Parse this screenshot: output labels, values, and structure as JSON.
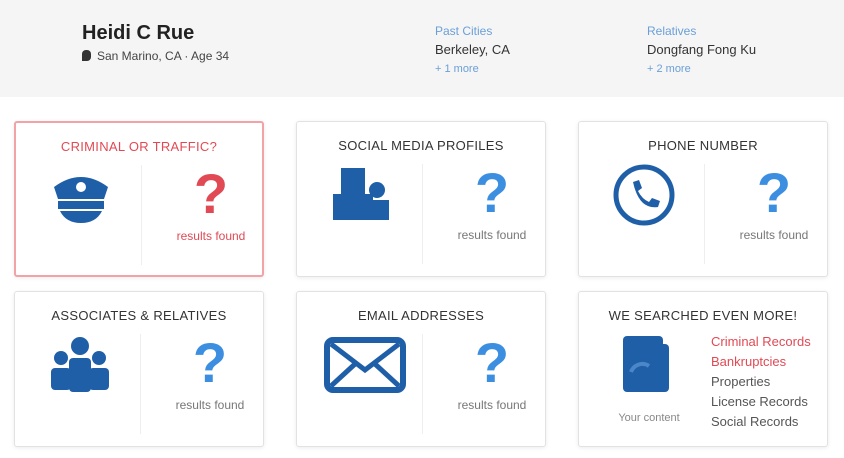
{
  "header": {
    "name": "Heidi C Rue",
    "location": "San Marino, CA · Age 34",
    "past_cities": {
      "label": "Past Cities",
      "value": "Berkeley, CA",
      "more": "+ 1 more"
    },
    "relatives": {
      "label": "Relatives",
      "value": "Dongfang Fong Ku",
      "more": "+ 2 more"
    }
  },
  "cards": [
    {
      "title": "CRIMINAL OR TRAFFIC?",
      "q": "?",
      "result": "results found"
    },
    {
      "title": "SOCIAL MEDIA PROFILES",
      "q": "?",
      "result": "results found"
    },
    {
      "title": "PHONE NUMBER",
      "q": "?",
      "result": "results found"
    },
    {
      "title": "ASSOCIATES & RELATIVES",
      "q": "?",
      "result": "results found"
    },
    {
      "title": "EMAIL ADDRESSES",
      "q": "?",
      "result": "results found"
    },
    {
      "title": "WE SEARCHED EVEN MORE!",
      "caption": "Your content",
      "items": [
        "Criminal Records",
        "Bankruptcies",
        "Properties",
        "License Records",
        "Social Records"
      ]
    }
  ],
  "colors": {
    "accent": "#1f5fa8",
    "alert": "#e14a55",
    "link": "#6a9fd8"
  }
}
